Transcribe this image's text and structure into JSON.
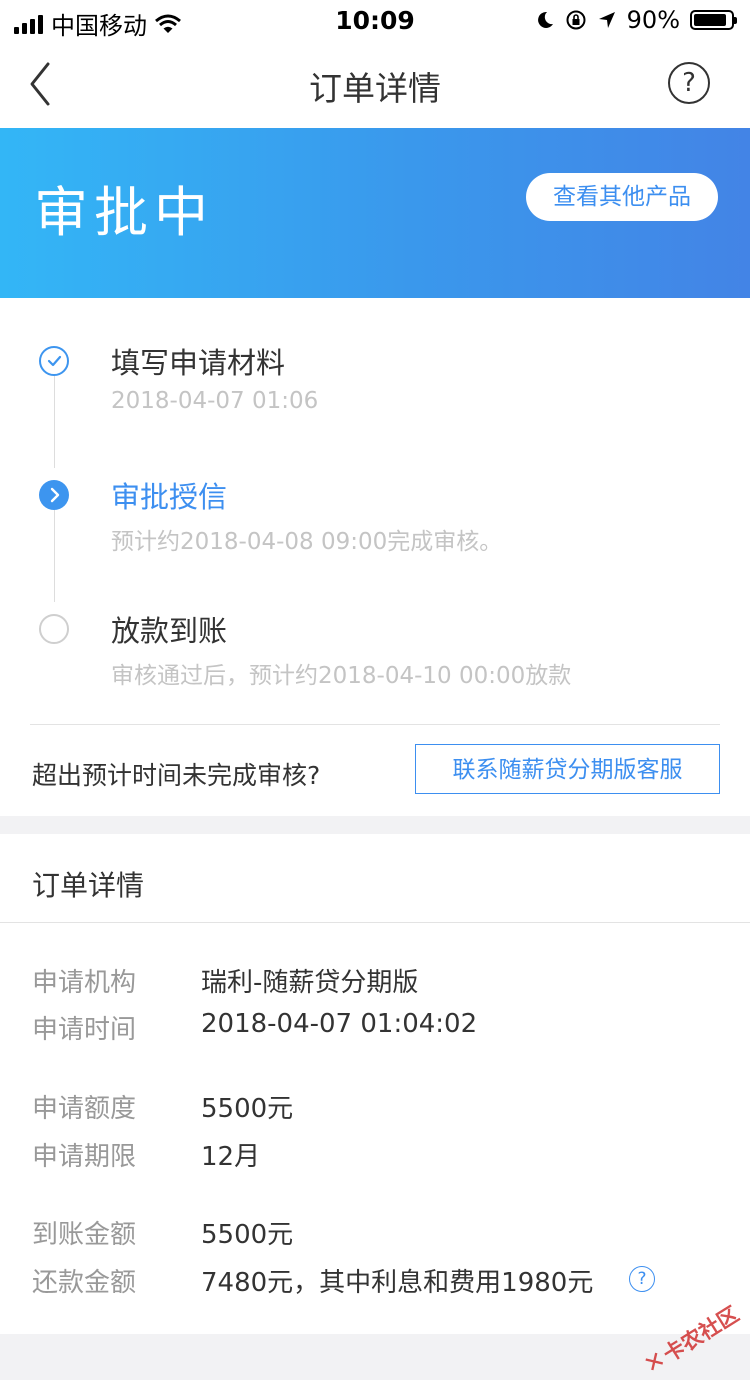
{
  "status_bar": {
    "carrier": "中国移动",
    "time": "10:09",
    "battery_percent": "90%",
    "battery_level": 0.9
  },
  "nav": {
    "title": "订单详情",
    "help_symbol": "?"
  },
  "banner": {
    "status": "审批中",
    "button_label": "查看其他产品",
    "gradient_from": "#33b6f6",
    "gradient_to": "#4384e6"
  },
  "steps": [
    {
      "title": "填写申请材料",
      "subtitle": "2018-04-07 01:06",
      "state": "done"
    },
    {
      "title": "审批授信",
      "subtitle": "预计约2018-04-08 09:00完成审核。",
      "state": "current"
    },
    {
      "title": "放款到账",
      "subtitle": "审核通过后，预计约2018-04-10 00:00放款",
      "state": "pending"
    }
  ],
  "help": {
    "question": "超出预计时间未完成审核?",
    "button_label": "联系随薪贷分期版客服"
  },
  "details": {
    "header": "订单详情",
    "rows": [
      {
        "label": "申请机构",
        "value": "瑞利-随薪贷分期版"
      },
      {
        "label": "申请时间",
        "value": "2018-04-07 01:04:02"
      },
      {
        "label": "申请额度",
        "value": "5500元"
      },
      {
        "label": "申请期限",
        "value": "12月"
      },
      {
        "label": "到账金额",
        "value": "5500元"
      },
      {
        "label": "还款金额",
        "value": "7480元，其中利息和费用1980元"
      }
    ],
    "info_symbol": "?"
  },
  "watermark": "卡农社区",
  "colors": {
    "accent": "#3d8ff0",
    "muted_text": "#999999",
    "background": "#f2f2f4"
  }
}
